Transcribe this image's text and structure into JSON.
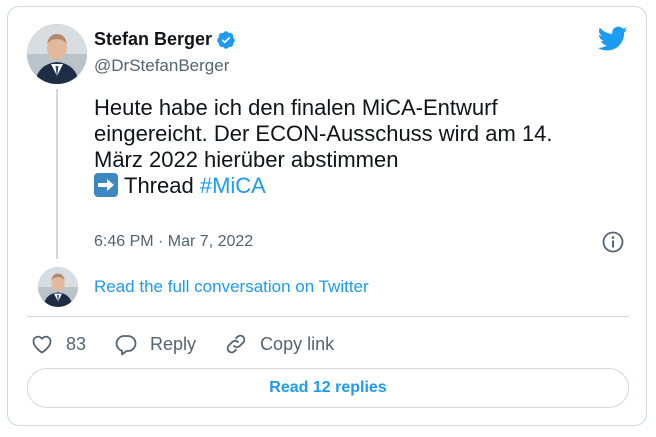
{
  "author": {
    "name": "Stefan Berger",
    "handle": "@DrStefanBerger",
    "verified": true,
    "avatar": "profile-photo-man-in-suit"
  },
  "brand": {
    "logo": "twitter-bird-icon",
    "color": "#1d9bf0"
  },
  "tweet": {
    "lines": [
      "Heute habe ich den finalen MiCA-Entwurf",
      "eingereicht. Der ECON-Ausschuss wird am 14.",
      "März 2022 hierüber abstimmen"
    ],
    "thread_emoji": "right-arrow-emoji",
    "thread_word": "Thread",
    "hashtag": "#MiCA",
    "timestamp": "6:46 PM · Mar 7, 2022"
  },
  "conversation": {
    "link_label": "Read the full conversation on Twitter"
  },
  "actions": {
    "like_count": "83",
    "reply_label": "Reply",
    "copy_link_label": "Copy link"
  },
  "replies_button": "Read 12 replies",
  "colors": {
    "text": "#0f1419",
    "secondary": "#536471",
    "border": "#cfd9de",
    "link": "#1d9bf0"
  }
}
